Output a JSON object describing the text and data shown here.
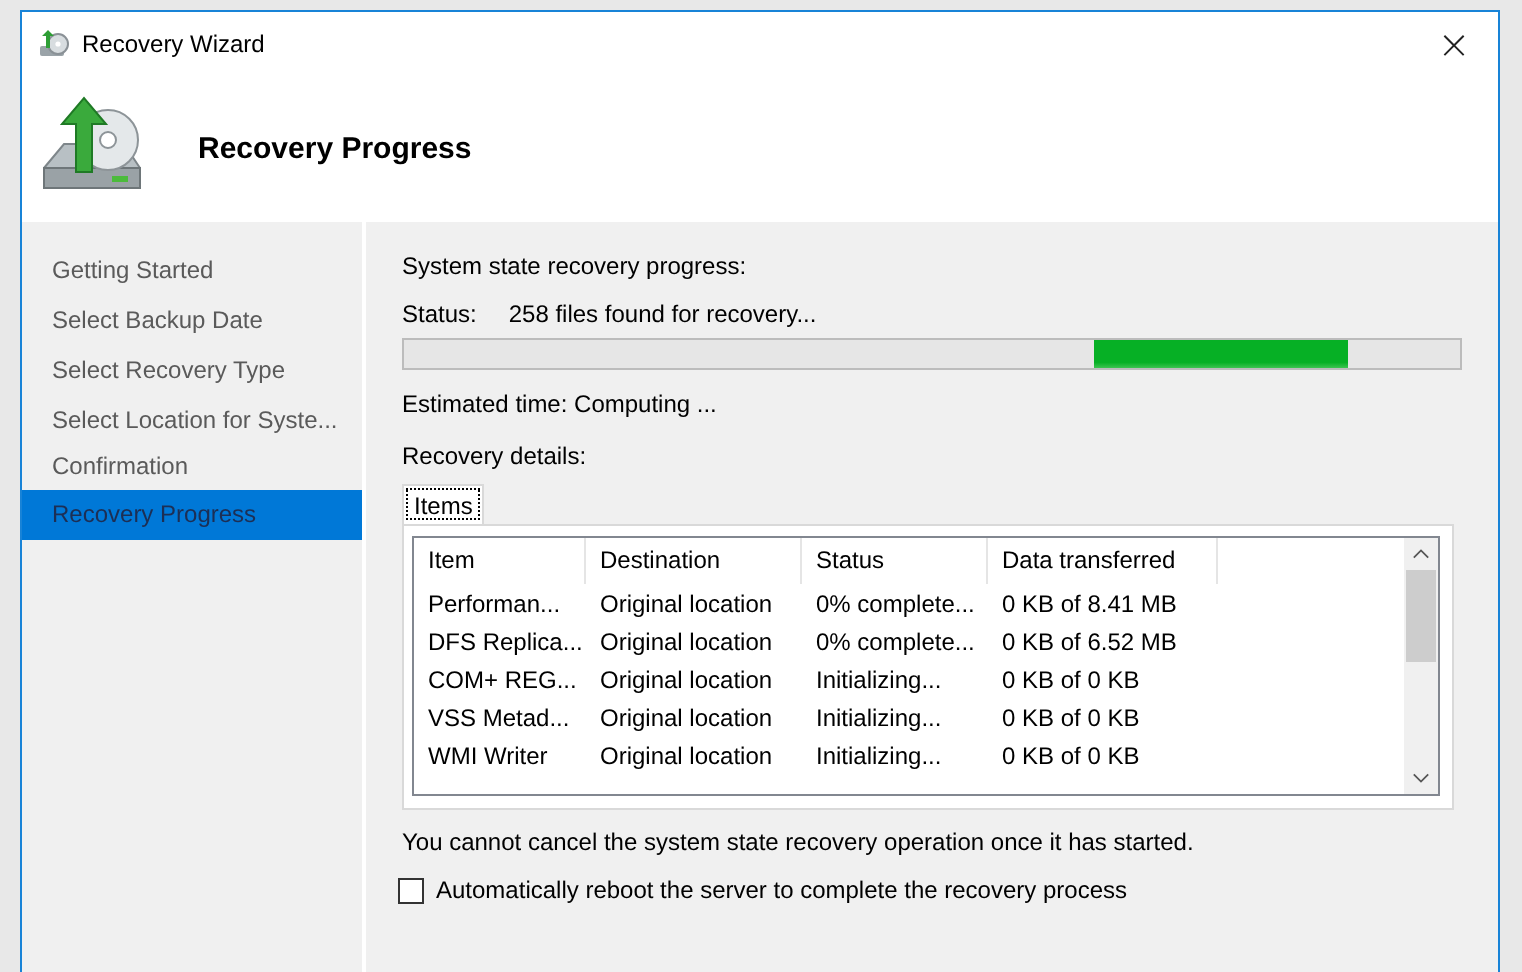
{
  "window": {
    "title": "Recovery Wizard",
    "close": "×"
  },
  "header": {
    "title": "Recovery Progress"
  },
  "steps": [
    {
      "label": "Getting Started",
      "selected": false
    },
    {
      "label": "Select Backup Date",
      "selected": false
    },
    {
      "label": "Select Recovery Type",
      "selected": false
    },
    {
      "label": "Select Location for Syste...",
      "selected": false
    },
    {
      "label": "Confirmation",
      "selected": false
    },
    {
      "label": "Recovery Progress",
      "selected": true
    }
  ],
  "progress": {
    "heading": "System state recovery progress:",
    "status_label": "Status:",
    "status_value": "258 files found for recovery...",
    "indeterminate": true,
    "estimated": "Estimated time: Computing ...",
    "details_label": "Recovery details:"
  },
  "tabs": [
    {
      "label": "Items",
      "selected": true
    }
  ],
  "table": {
    "columns": [
      "Item",
      "Destination",
      "Status",
      "Data transferred"
    ],
    "rows": [
      [
        "Performan...",
        "Original location",
        "0% complete...",
        "0 KB of 8.41 MB"
      ],
      [
        "DFS Replica...",
        "Original location",
        "0% complete...",
        "0 KB of 6.52 MB"
      ],
      [
        "COM+ REG...",
        "Original location",
        "Initializing...",
        "0 KB of 0 KB"
      ],
      [
        "VSS Metad...",
        "Original location",
        "Initializing...",
        "0 KB of 0 KB"
      ],
      [
        "WMI Writer",
        "Original location",
        "Initializing...",
        "0 KB of 0 KB"
      ]
    ]
  },
  "note": "You cannot cancel the system state recovery operation once it has started.",
  "reboot": {
    "label": "Automatically reboot the server to complete the recovery process",
    "checked": false
  }
}
